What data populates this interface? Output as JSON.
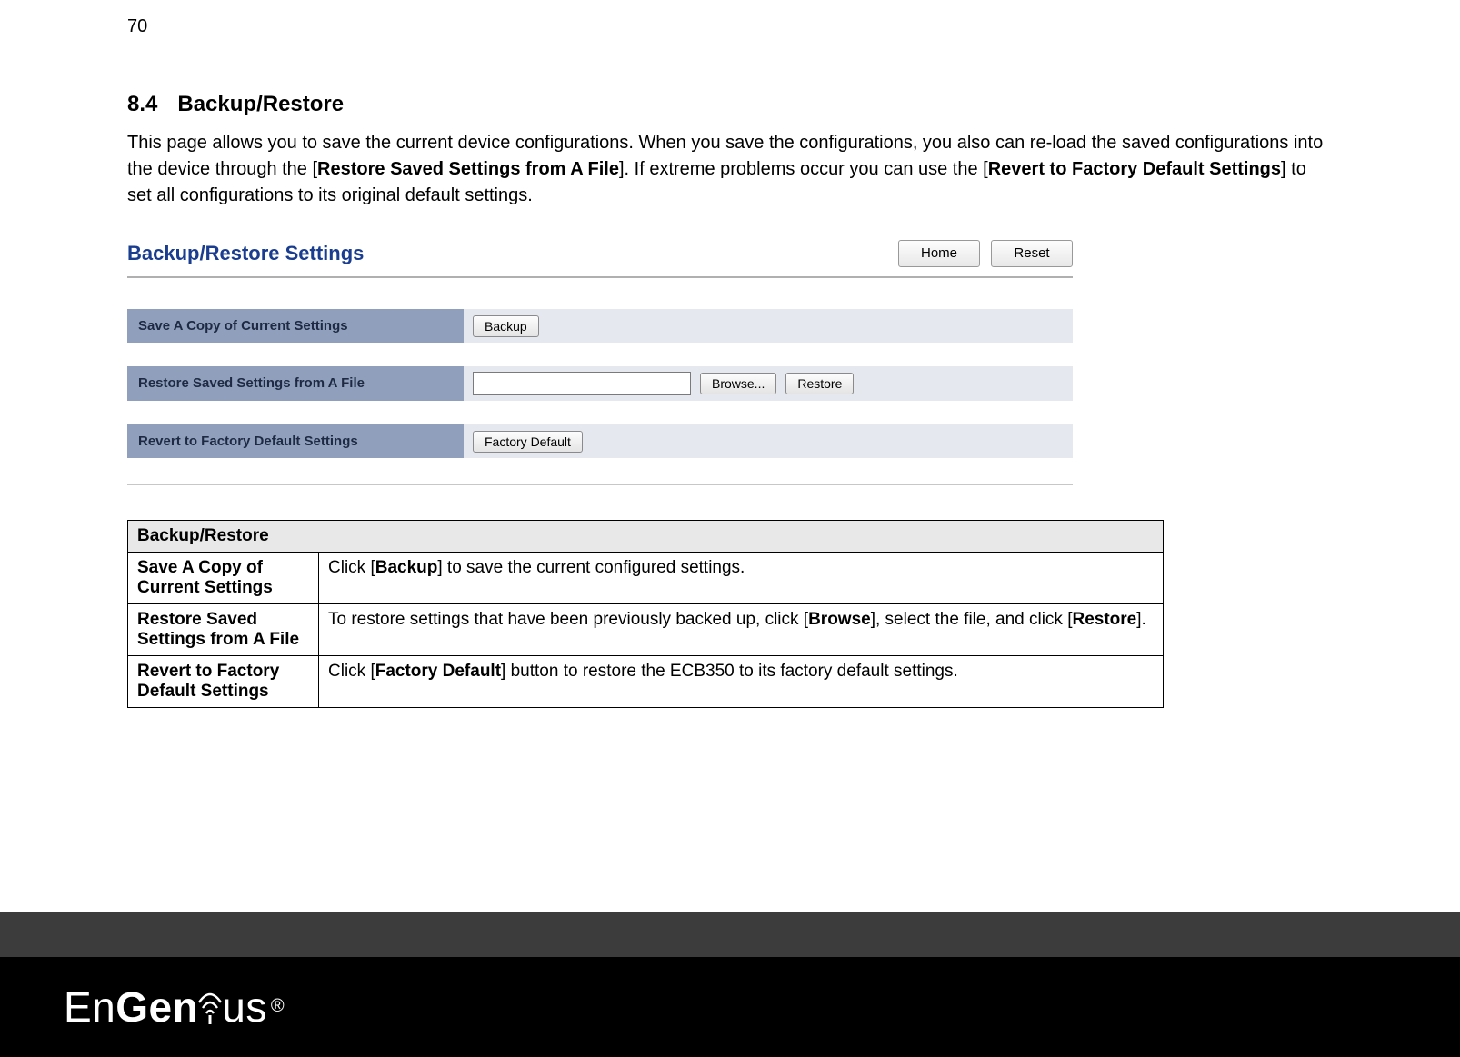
{
  "page_number": "70",
  "section_number": "8.4",
  "section_title": "Backup/Restore",
  "intro": {
    "t1": "This page allows you to save the current device configurations. When you save the configurations, you also can re-load the saved configurations into the device through the [",
    "b1": "Restore Saved Settings from A File",
    "t2": "]. If extreme problems occur you can use the [",
    "b2": "Revert to Factory Default Settings",
    "t3": "] to set all configurations to its original default settings."
  },
  "shot": {
    "title": "Backup/Restore Settings",
    "home": "Home",
    "reset": "Reset",
    "row1_label": "Save A Copy of Current Settings",
    "row1_btn": "Backup",
    "row2_label": "Restore Saved Settings from A File",
    "row2_browse": "Browse...",
    "row2_restore": "Restore",
    "row3_label": "Revert to Factory Default Settings",
    "row3_btn": "Factory Default"
  },
  "table": {
    "header": "Backup/Restore",
    "r1_label": "Save A Copy of Current Settings",
    "r1_pre": "Click [",
    "r1_bold": "Backup",
    "r1_post": "] to save the current configured settings.",
    "r2_label": "Restore Saved Settings from A File",
    "r2_pre": "To restore settings that have been previously backed up, click [",
    "r2_bold1": "Browse",
    "r2_mid": "], select the file, and click [",
    "r2_bold2": "Restore",
    "r2_post": "].",
    "r3_label": "Revert to Factory Default Settings",
    "r3_pre": "Click [",
    "r3_bold": "Factory Default",
    "r3_post": "] button to restore the ECB350 to its factory default settings."
  },
  "brand": {
    "part1": "En",
    "part2": "Gen",
    "part3": "us",
    "reg": "®"
  }
}
